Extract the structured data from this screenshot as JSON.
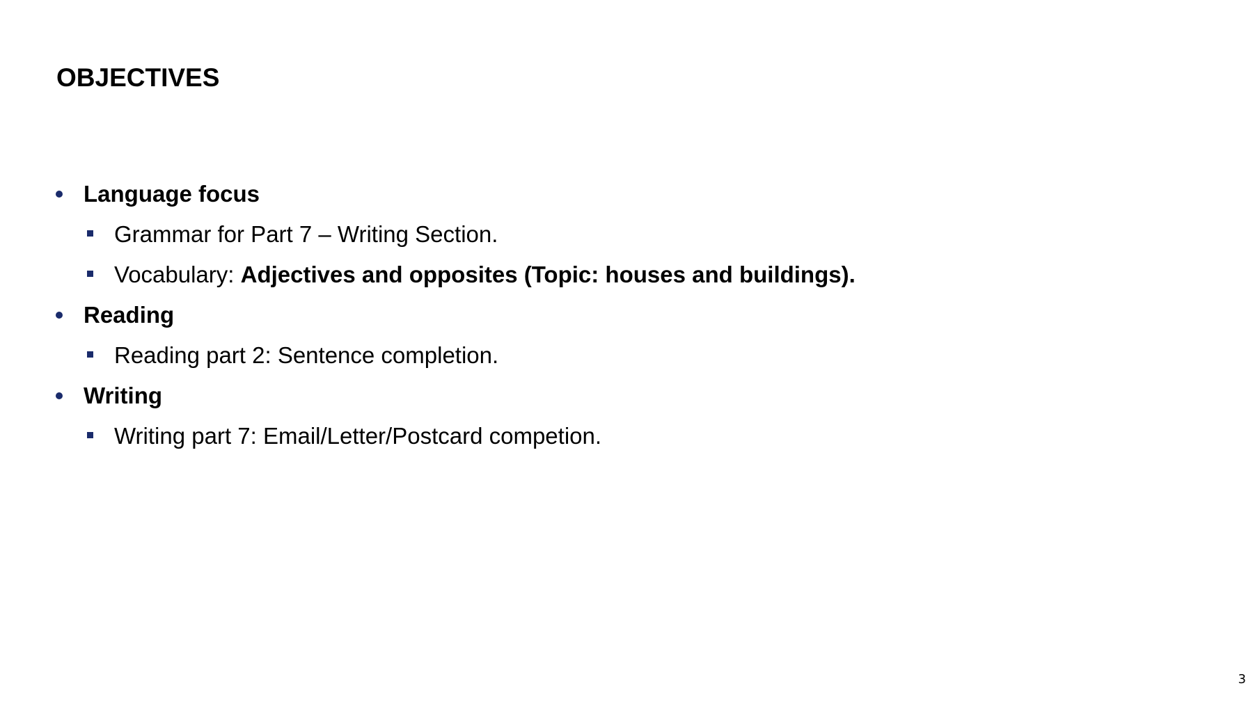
{
  "slide": {
    "title": "OBJECTIVES",
    "page_number": "3",
    "bullets": [
      {
        "text": "Language focus",
        "subitems": [
          {
            "text": "Grammar for Part 7 – Writing Section."
          },
          {
            "prefix": "Vocabulary: ",
            "bold_text": "Adjectives and opposites (Topic: houses and buildings)."
          }
        ]
      },
      {
        "text": "Reading",
        "subitems": [
          {
            "text": "Reading part 2: Sentence completion."
          }
        ]
      },
      {
        "text": "Writing",
        "subitems": [
          {
            "text": "Writing part 7: Email/Letter/Postcard competion."
          }
        ]
      }
    ]
  },
  "colors": {
    "bullet_marker": "#1a2b6b",
    "text": "#000000",
    "background": "#ffffff"
  },
  "icons": {
    "level1_marker": "round-bullet-icon",
    "level2_marker": "square-bullet-icon"
  }
}
